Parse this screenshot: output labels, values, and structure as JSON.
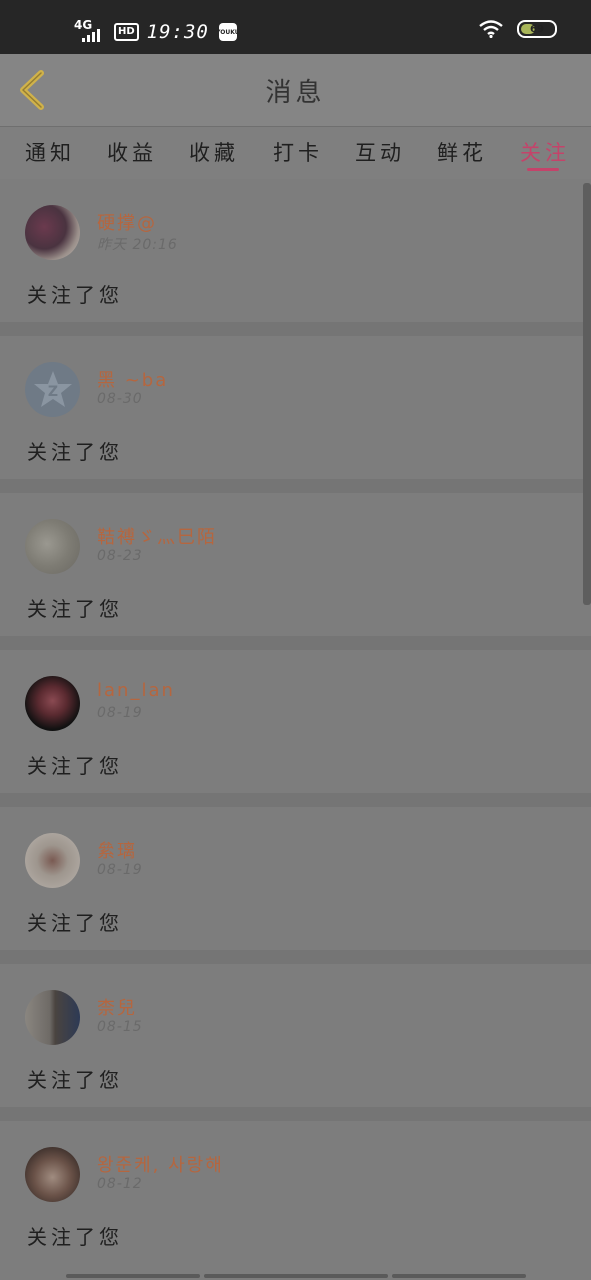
{
  "status_bar": {
    "network": "4G",
    "hd": "HD",
    "time": "19:30",
    "app_chip": "YOUKU",
    "battery": "69"
  },
  "header": {
    "title": "消息"
  },
  "tabs": [
    {
      "label": "通知",
      "active": false
    },
    {
      "label": "收益",
      "active": false
    },
    {
      "label": "收藏",
      "active": false
    },
    {
      "label": "打卡",
      "active": false
    },
    {
      "label": "互动",
      "active": false
    },
    {
      "label": "鲜花",
      "active": false
    },
    {
      "label": "关注",
      "active": true
    }
  ],
  "messages": [
    {
      "name": "硬撑@",
      "date": "昨天 20:16",
      "text": "关注了您"
    },
    {
      "name": "黑 ~ba",
      "date": "08-30",
      "text": "关注了您"
    },
    {
      "name": "鞊禣ゞ灬巳陌",
      "date": "08-23",
      "text": "关注了您"
    },
    {
      "name": "lan_lan",
      "date": "08-19",
      "text": "关注了您"
    },
    {
      "name": "絫璃",
      "date": "08-19",
      "text": "关注了您"
    },
    {
      "name": "柰兒",
      "date": "08-15",
      "text": "关注了您"
    },
    {
      "name": "왕준케, 사랑해",
      "date": "08-12",
      "text": "关注了您"
    }
  ],
  "colors": {
    "accent": "#c4436a",
    "username": "#b5663f",
    "back_icon": "#d0b24a",
    "overlay_bg": "#7d7d7d"
  }
}
